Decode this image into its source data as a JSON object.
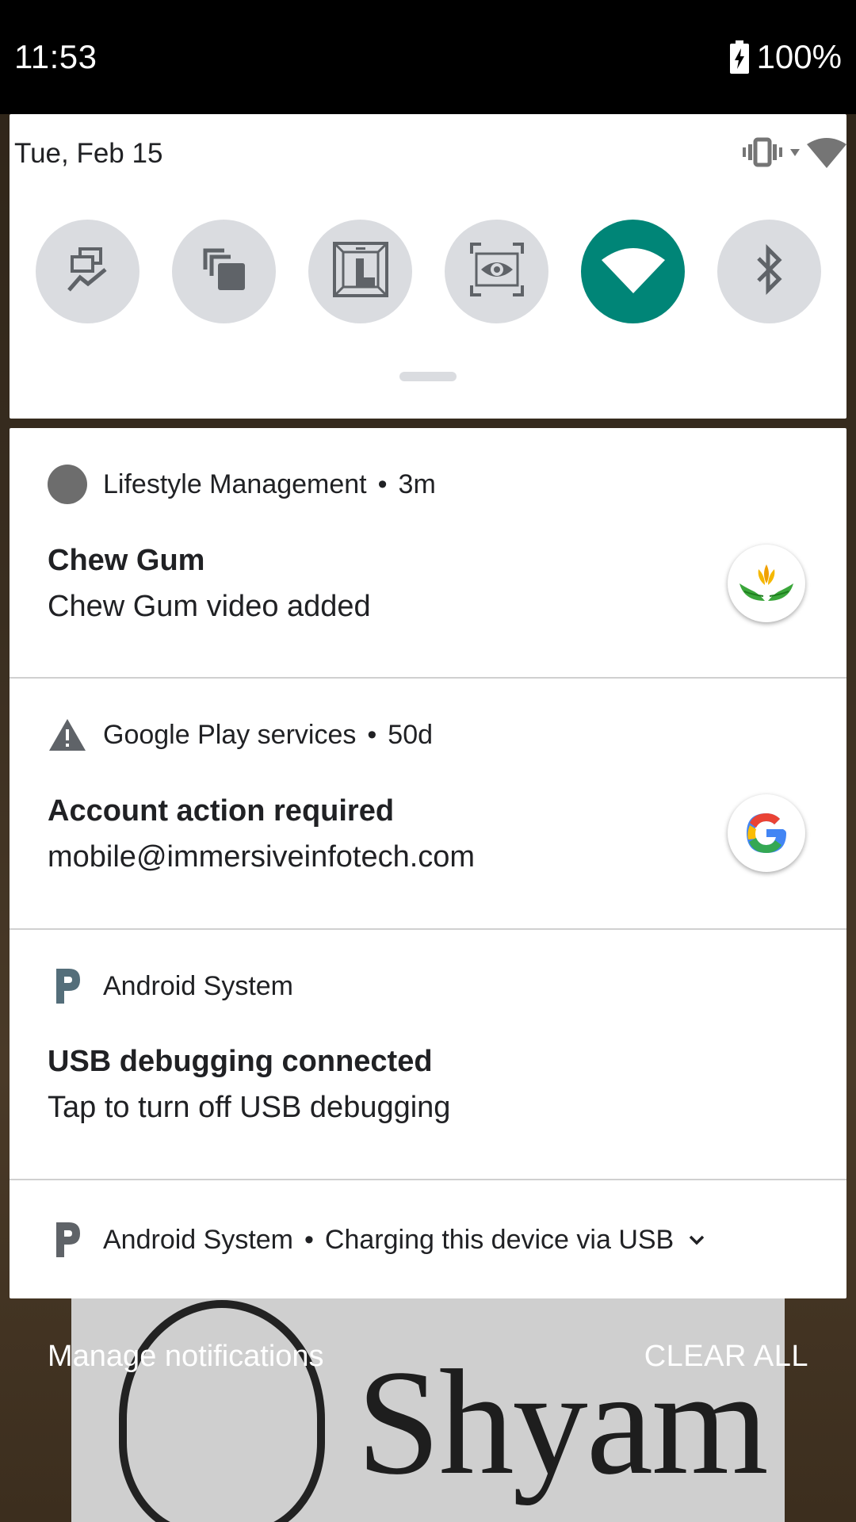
{
  "status_bar": {
    "time": "11:53",
    "battery": "100%"
  },
  "quick_settings": {
    "date": "Tue, Feb 15",
    "tiles": [
      {
        "icon": "data-usage-icon",
        "active": false
      },
      {
        "icon": "cast-screens-icon",
        "active": false
      },
      {
        "icon": "layout-bounds-icon",
        "active": false
      },
      {
        "icon": "screen-view-icon",
        "active": false
      },
      {
        "icon": "wifi-icon",
        "active": true
      },
      {
        "icon": "bluetooth-icon",
        "active": false
      }
    ],
    "active_color": "#008577"
  },
  "notifications": [
    {
      "app": "Lifestyle Management",
      "time": "3m",
      "title": "Chew Gum",
      "text": "Chew Gum video added",
      "app_icon": "circle-icon",
      "large_icon": "lifestyle-logo-icon"
    },
    {
      "app": "Google Play services",
      "time": "50d",
      "title": "Account action required",
      "text": "mobile@immersiveinfotech.com",
      "app_icon": "warning-icon",
      "large_icon": "google-logo-icon"
    },
    {
      "app": "Android System",
      "title": "USB debugging connected",
      "text": "Tap to turn off USB debugging",
      "app_icon": "android-p-icon"
    },
    {
      "app": "Android System",
      "summary": "Charging this device via USB",
      "app_icon": "android-p-icon"
    }
  ],
  "footer": {
    "manage": "Manage notifications",
    "clear_all": "CLEAR ALL"
  },
  "wallpaper": {
    "text": "Shyam"
  }
}
